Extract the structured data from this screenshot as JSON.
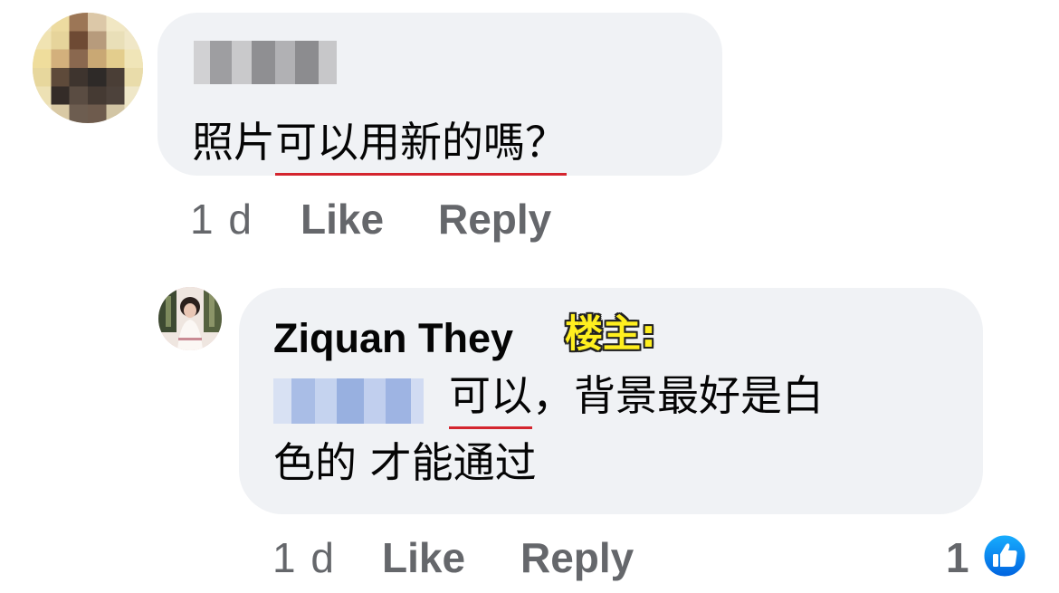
{
  "comments": [
    {
      "text_before": "照片",
      "text_underlined": "可以用新的嗎？",
      "actions": {
        "time": "1 d",
        "like": "Like",
        "reply": "Reply"
      }
    },
    {
      "author": "Ziquan They",
      "op_badge": "楼主:",
      "text_underlined": "可以",
      "text_after": "，背景最好是白",
      "text_line2": "色的 才能通过",
      "actions": {
        "time": "1 d",
        "like": "Like",
        "reply": "Reply"
      },
      "reactions": {
        "count": "1",
        "icon": "like-thumb-icon",
        "color": "#1877f2"
      }
    }
  ],
  "colors": {
    "bubble_bg": "#f0f2f5",
    "underline": "#d4252e",
    "meta_text": "#65676b",
    "badge_fill": "#ffef1f"
  }
}
